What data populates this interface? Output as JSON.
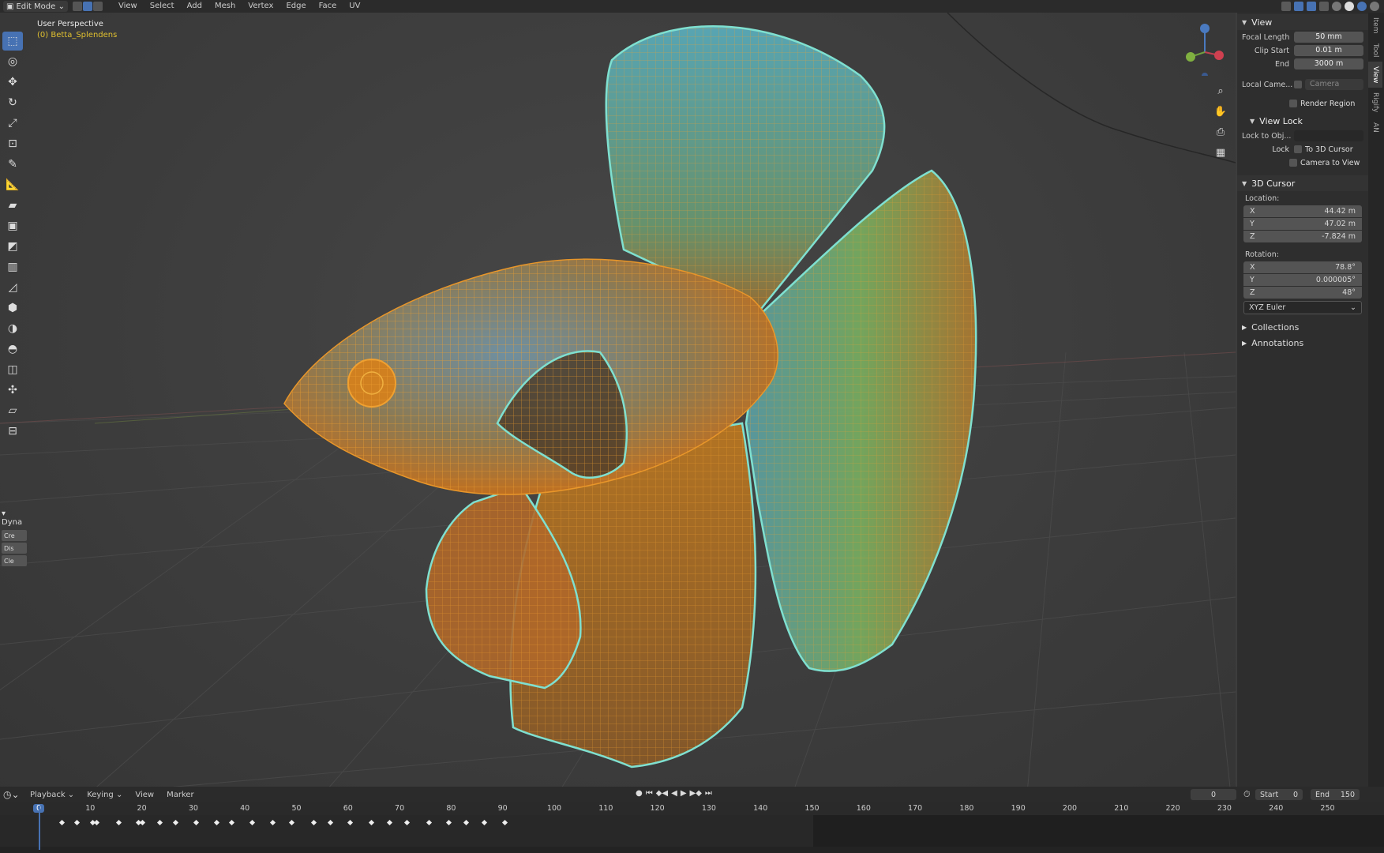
{
  "header": {
    "mode": "Edit Mode",
    "menus": [
      "View",
      "Select",
      "Add",
      "Mesh",
      "Vertex",
      "Edge",
      "Face",
      "UV"
    ]
  },
  "viewport": {
    "title": "User Perspective",
    "object": "(0) Betta_Splendens"
  },
  "toolbar": {
    "tools": [
      "select-box",
      "cursor",
      "move",
      "rotate",
      "scale",
      "transform",
      "annotate",
      "measure",
      "extrude",
      "inset",
      "bevel",
      "loop-cut",
      "knife",
      "poly-build",
      "spin",
      "smooth",
      "edge-slide",
      "shrink-fatten",
      "shear",
      "rip"
    ],
    "dyna_panel": {
      "title": "Dyna",
      "items": [
        "Cre",
        "Dis",
        "Cle"
      ]
    }
  },
  "npanel": {
    "tabs": [
      "Item",
      "Tool",
      "View",
      "Rigify",
      "AN"
    ],
    "active_tab": "View",
    "view": {
      "title": "View",
      "focal_length_label": "Focal Length",
      "focal_length": "50 mm",
      "clip_start_label": "Clip Start",
      "clip_start": "0.01 m",
      "clip_end_label": "End",
      "clip_end": "3000 m",
      "local_camera_label": "Local Came...",
      "local_camera_value": "Camera",
      "render_region": "Render Region"
    },
    "view_lock": {
      "title": "View Lock",
      "lock_to_obj_label": "Lock to Obj...",
      "lock_label": "Lock",
      "to_3d_cursor": "To 3D Cursor",
      "camera_to_view": "Camera to View"
    },
    "cursor": {
      "title": "3D Cursor",
      "location_label": "Location:",
      "loc_x": "44.42 m",
      "loc_y": "47.02 m",
      "loc_z": "-7.824 m",
      "rotation_label": "Rotation:",
      "rot_x": "78.8°",
      "rot_y": "0.000005°",
      "rot_z": "48°",
      "rotation_mode": "XYZ Euler"
    },
    "collections": "Collections",
    "annotations": "Annotations"
  },
  "timeline": {
    "menus": [
      "Playback",
      "Keying",
      "View",
      "Marker"
    ],
    "current_frame": "0",
    "start_label": "Start",
    "start": "0",
    "end_label": "End",
    "end": "150",
    "ruler": [
      "0",
      "10",
      "20",
      "30",
      "40",
      "50",
      "60",
      "70",
      "80",
      "90",
      "100",
      "110",
      "120",
      "130",
      "140",
      "150",
      "160",
      "170",
      "180",
      "190",
      "200",
      "210",
      "220",
      "230",
      "240",
      "250"
    ]
  },
  "colors": {
    "accent": "#4772b3",
    "wire": "#e8962a",
    "selection_outline": "#7fe0d0",
    "object_label": "#e0c030"
  }
}
